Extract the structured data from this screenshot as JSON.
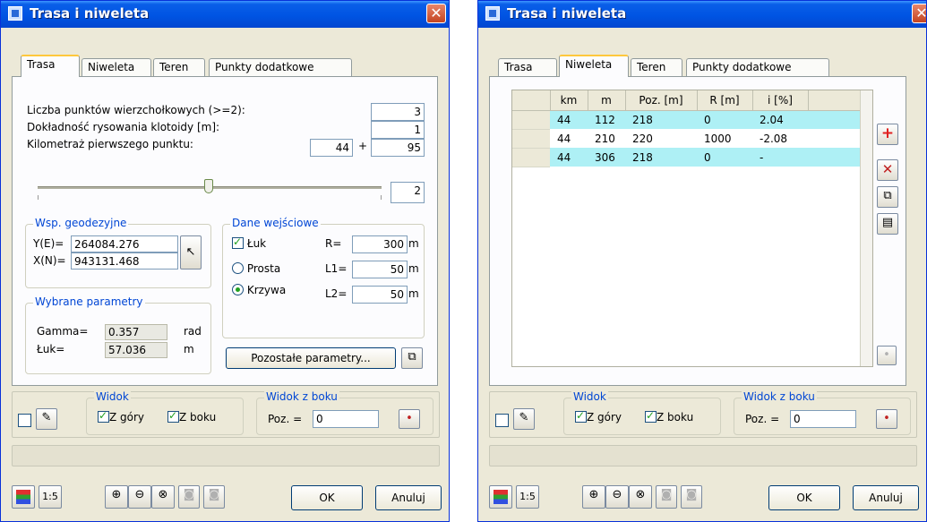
{
  "colors": {
    "titlebar": "#0054e3",
    "highlight_row": "#aef0f5",
    "group_title": "#0046d5",
    "add_icon": "#e02020"
  },
  "left": {
    "title": "Trasa i niweleta",
    "tabs": [
      "Trasa",
      "Niweleta",
      "Teren",
      "Punkty dodatkowe"
    ],
    "active_tab": "Trasa",
    "fields": {
      "vertices_label": "Liczba punktów wierzchołkowych (>=2):",
      "vertices_value": "3",
      "clothoid_label": "Dokładność rysowania klotoidy [m]:",
      "clothoid_value": "1",
      "chainage_label": "Kilometraż pierwszego punktu:",
      "chainage_km": "44",
      "plus": "+",
      "chainage_m": "95",
      "slider_value": "2"
    },
    "geodetic": {
      "title": "Wsp. geodezyjne",
      "y_label": "Y(E)=",
      "y_value": "264084.276",
      "x_label": "X(N)=",
      "x_value": "943131.468"
    },
    "params": {
      "title": "Wybrane parametry",
      "gamma_label": "Gamma=",
      "gamma_value": "0.357",
      "gamma_unit": "rad",
      "arc_label": "Łuk=",
      "arc_value": "57.036",
      "arc_unit": "m"
    },
    "input_data": {
      "title": "Dane wejściowe",
      "arc_check": "Łuk",
      "straight": "Prosta",
      "curve": "Krzywa",
      "r_label": "R=",
      "r_value": "300",
      "l1_label": "L1=",
      "l1_value": "50",
      "l2_label": "L2=",
      "l2_value": "50",
      "unit": "m"
    },
    "other_params_button": "Pozostałe parametry...",
    "view": {
      "title": "Widok",
      "top": "Z góry",
      "side": "Z boku"
    },
    "side_view": {
      "title": "Widok z boku",
      "poz_label": "Poz. =",
      "poz_value": "0"
    },
    "scale_button": "1:5",
    "ok": "OK",
    "cancel": "Anuluj"
  },
  "right": {
    "title": "Trasa i niweleta",
    "tabs": [
      "Trasa",
      "Niweleta",
      "Teren",
      "Punkty dodatkowe"
    ],
    "active_tab": "Niweleta",
    "table": {
      "columns": [
        "km",
        "m",
        "Poz. [m]",
        "R [m]",
        "i [%]"
      ],
      "rows": [
        [
          "44",
          "112",
          "218",
          "0",
          "2.04"
        ],
        [
          "44",
          "210",
          "220",
          "1000",
          "-2.08"
        ],
        [
          "44",
          "306",
          "218",
          "0",
          "-"
        ]
      ]
    },
    "view": {
      "title": "Widok",
      "top": "Z góry",
      "side": "Z boku"
    },
    "side_view": {
      "title": "Widok z boku",
      "poz_label": "Poz. =",
      "poz_value": "0"
    },
    "scale_button": "1:5",
    "ok": "OK",
    "cancel": "Anuluj"
  }
}
